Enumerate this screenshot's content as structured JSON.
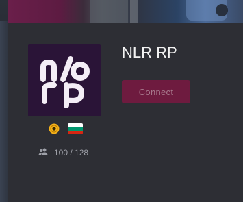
{
  "server": {
    "name": "NLR RP",
    "logo_text": "nlrp",
    "players": "100 / 128",
    "flag_country": "Bulgaria"
  },
  "actions": {
    "connect_label": "Connect"
  },
  "icons": {
    "verified": "verified-badge-icon",
    "players": "users-icon",
    "flag": "bulgaria-flag-icon"
  },
  "colors": {
    "accent": "#6e1b3f",
    "accent_text": "#a7788c",
    "logo_bg": "#2a1437",
    "card_bg": "#2d2e34",
    "flag_white": "#ffffff",
    "flag_green": "#00966e",
    "flag_red": "#d62612",
    "verified_gold": "#f5b21a"
  }
}
